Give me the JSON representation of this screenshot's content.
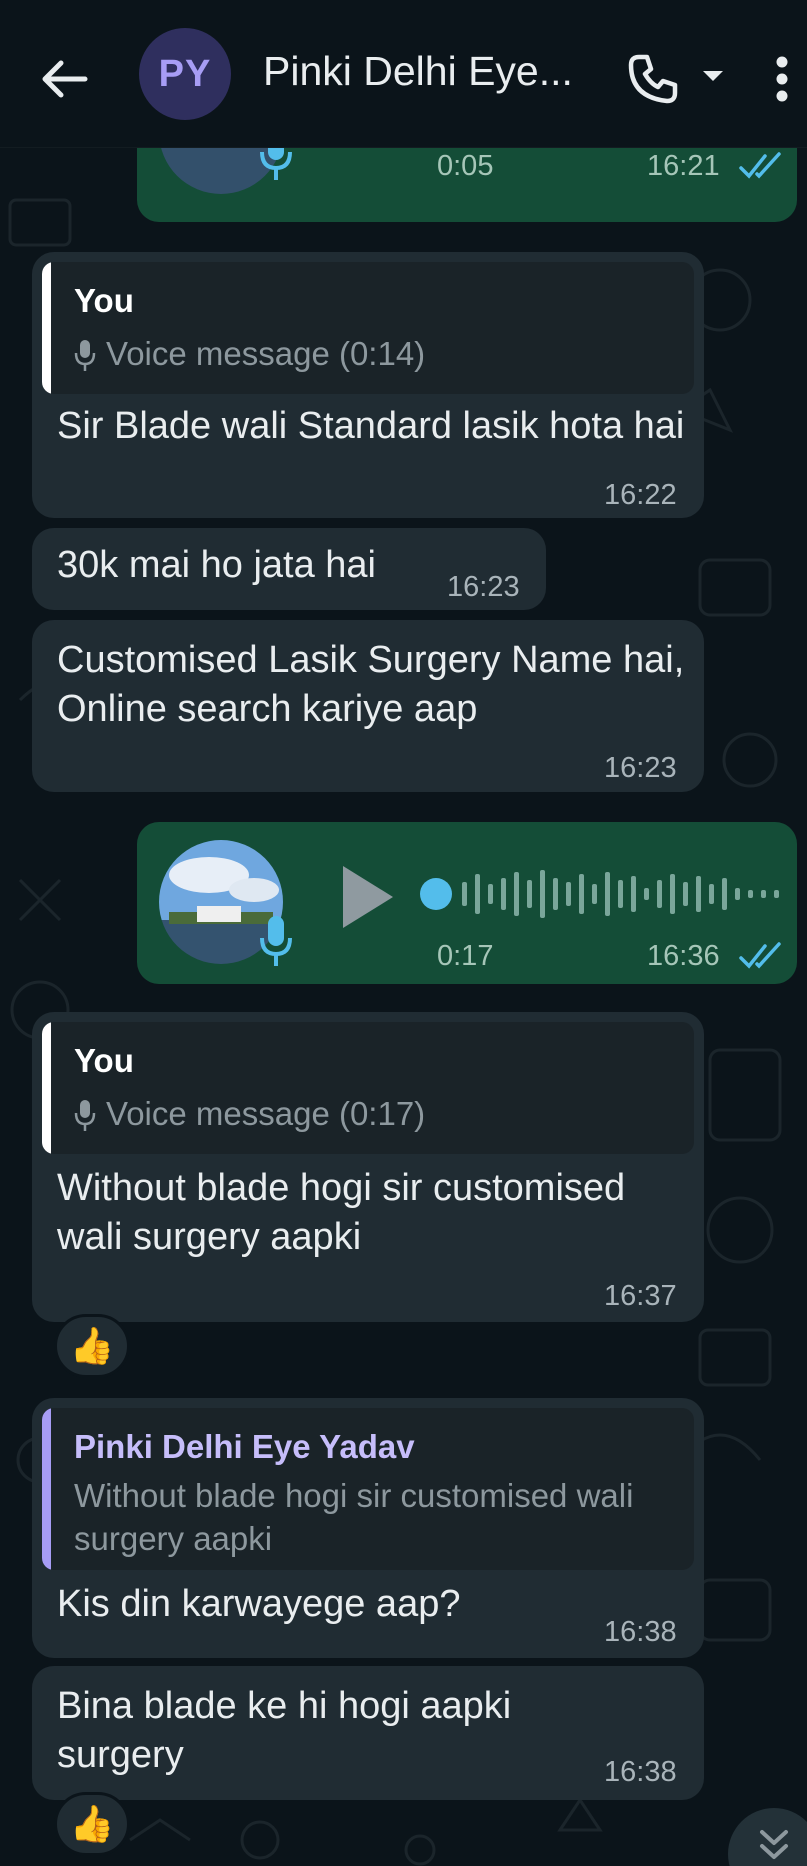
{
  "header": {
    "avatar_initials": "PY",
    "contact_name": "Pinki Delhi Eye..."
  },
  "messages": {
    "voice1": {
      "duration": "0:05",
      "time": "16:21",
      "status": "read"
    },
    "m1": {
      "quote_author": "You",
      "quote_text": "Voice message (0:14)",
      "text": "Sir Blade wali Standard lasik hota hai",
      "time": "16:22"
    },
    "m2": {
      "text": "30k mai ho jata hai",
      "time": "16:23"
    },
    "m3": {
      "text": "Customised Lasik Surgery Name hai, Online search kariye aap",
      "time": "16:23"
    },
    "voice2": {
      "duration": "0:17",
      "time": "16:36",
      "status": "read"
    },
    "m4": {
      "quote_author": "You",
      "quote_text": "Voice message (0:17)",
      "text": "Without blade hogi sir customised wali surgery aapki",
      "time": "16:37",
      "reaction": "👍"
    },
    "m5": {
      "quote_author": "Pinki Delhi Eye Yadav",
      "quote_text": "Without blade hogi sir customised wali surgery aapki",
      "text": "Kis din karwayege aap?",
      "time": "16:38"
    },
    "m6": {
      "text": "Bina blade ke hi hogi aapki surgery",
      "time": "16:38",
      "reaction": "👍"
    }
  },
  "colors": {
    "background": "#0b141a",
    "incoming_bubble": "#202c33",
    "outgoing_bubble": "#144d37",
    "read_ticks": "#53bdeb",
    "avatar_bg": "#2f2f5e"
  },
  "icons": [
    "back-arrow-icon",
    "phone-icon",
    "dropdown-caret-icon",
    "more-vert-icon",
    "microphone-icon",
    "play-icon",
    "double-check-icon",
    "thumbs-up-icon",
    "chevron-double-down-icon"
  ]
}
